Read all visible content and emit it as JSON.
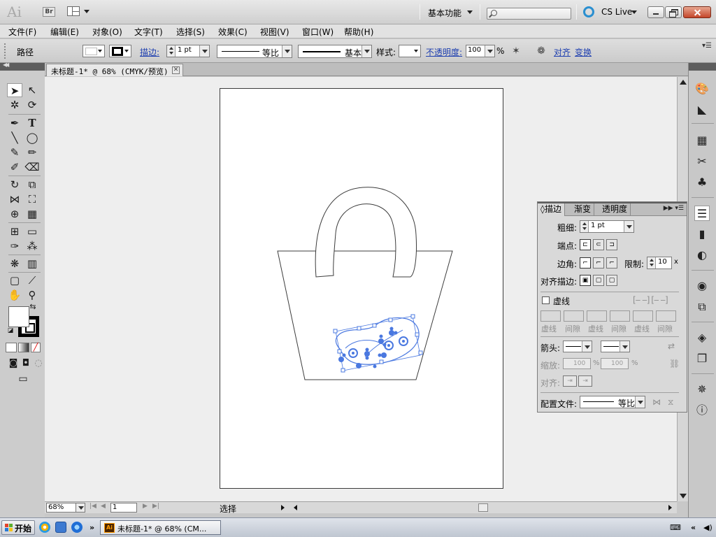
{
  "app": {
    "logo": "Ai",
    "bridge_label": "Br",
    "workspace": "基本功能",
    "cslive": "CS Live"
  },
  "menu": [
    "文件(F)",
    "编辑(E)",
    "对象(O)",
    "文字(T)",
    "选择(S)",
    "效果(C)",
    "视图(V)",
    "窗口(W)",
    "帮助(H)"
  ],
  "control": {
    "object_type": "路径",
    "stroke_label": "描边:",
    "stroke_weight": "1 pt",
    "profile_label": "等比",
    "brush_label": "基本",
    "style_label": "样式:",
    "opacity_label": "不透明度:",
    "opacity_value": "100",
    "opacity_unit": "%",
    "align_label": "对齐",
    "transform_label": "变换"
  },
  "document": {
    "tab_title": "未标题-1* @ 68% (CMYK/预览)",
    "close_glyph": "✕"
  },
  "status": {
    "zoom": "68%",
    "page": "1",
    "tool_status": "选择"
  },
  "stroke_panel": {
    "tabs": [
      "描边",
      "渐变",
      "透明度"
    ],
    "weight_label": "粗细:",
    "weight_value": "1 pt",
    "cap_label": "端点:",
    "corner_label": "边角:",
    "limit_label": "限制:",
    "limit_value": "10",
    "limit_unit": "x",
    "align_label": "对齐描边:",
    "dashed_label": "虚线",
    "dash_labels": [
      "虚线",
      "间隙",
      "虚线",
      "间隙",
      "虚线",
      "间隙"
    ],
    "arrow_label": "箭头:",
    "scale_label": "缩放:",
    "scale_value_1": "100",
    "scale_value_2": "100",
    "scale_unit": "%",
    "align2_label": "对齐:",
    "profile_label": "配置文件:",
    "profile_value": "等比"
  },
  "taskbar": {
    "start": "开始",
    "more": "»",
    "task_icon": "Ai",
    "task_label": "未标题-1* @ 68% (CM..."
  },
  "colors": {
    "selection": "#4a78e0",
    "artboard_border": "#3c3c3c",
    "link": "#1e3fb0"
  }
}
